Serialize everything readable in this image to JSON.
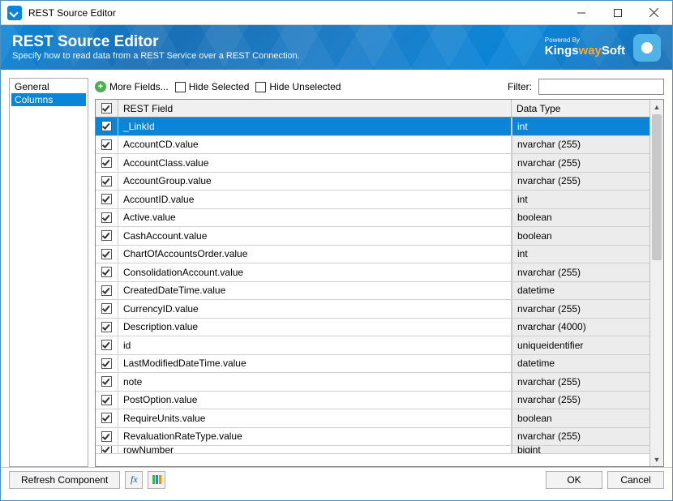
{
  "window": {
    "title": "REST Source Editor"
  },
  "banner": {
    "title": "REST Source Editor",
    "subtitle": "Specify how to read data from a REST Service over a REST Connection."
  },
  "brand": {
    "powered": "Powered By",
    "name_pre": "Kings",
    "name_mid": "way",
    "name_post": "Soft"
  },
  "sidebar": {
    "items": [
      {
        "label": "General",
        "selected": false
      },
      {
        "label": "Columns",
        "selected": true
      }
    ]
  },
  "toolbar": {
    "more_fields": "More Fields...",
    "hide_selected": "Hide Selected",
    "hide_unselected": "Hide Unselected",
    "filter_label": "Filter:",
    "filter_value": ""
  },
  "grid": {
    "header_field": "REST Field",
    "header_type": "Data Type",
    "rows": [
      {
        "field": "_LinkId",
        "type": "int",
        "checked": true,
        "selected": true
      },
      {
        "field": "AccountCD.value",
        "type": "nvarchar (255)",
        "checked": true
      },
      {
        "field": "AccountClass.value",
        "type": "nvarchar (255)",
        "checked": true
      },
      {
        "field": "AccountGroup.value",
        "type": "nvarchar (255)",
        "checked": true
      },
      {
        "field": "AccountID.value",
        "type": "int",
        "checked": true
      },
      {
        "field": "Active.value",
        "type": "boolean",
        "checked": true
      },
      {
        "field": "CashAccount.value",
        "type": "boolean",
        "checked": true
      },
      {
        "field": "ChartOfAccountsOrder.value",
        "type": "int",
        "checked": true
      },
      {
        "field": "ConsolidationAccount.value",
        "type": "nvarchar (255)",
        "checked": true
      },
      {
        "field": "CreatedDateTime.value",
        "type": "datetime",
        "checked": true
      },
      {
        "field": "CurrencyID.value",
        "type": "nvarchar (255)",
        "checked": true
      },
      {
        "field": "Description.value",
        "type": "nvarchar (4000)",
        "checked": true
      },
      {
        "field": "id",
        "type": "uniqueidentifier",
        "checked": true
      },
      {
        "field": "LastModifiedDateTime.value",
        "type": "datetime",
        "checked": true
      },
      {
        "field": "note",
        "type": "nvarchar (255)",
        "checked": true
      },
      {
        "field": "PostOption.value",
        "type": "nvarchar (255)",
        "checked": true
      },
      {
        "field": "RequireUnits.value",
        "type": "boolean",
        "checked": true
      },
      {
        "field": "RevaluationRateType.value",
        "type": "nvarchar (255)",
        "checked": true
      },
      {
        "field": "rowNumber",
        "type": "bigint",
        "checked": true
      }
    ]
  },
  "footer": {
    "refresh": "Refresh Component",
    "ok": "OK",
    "cancel": "Cancel"
  }
}
